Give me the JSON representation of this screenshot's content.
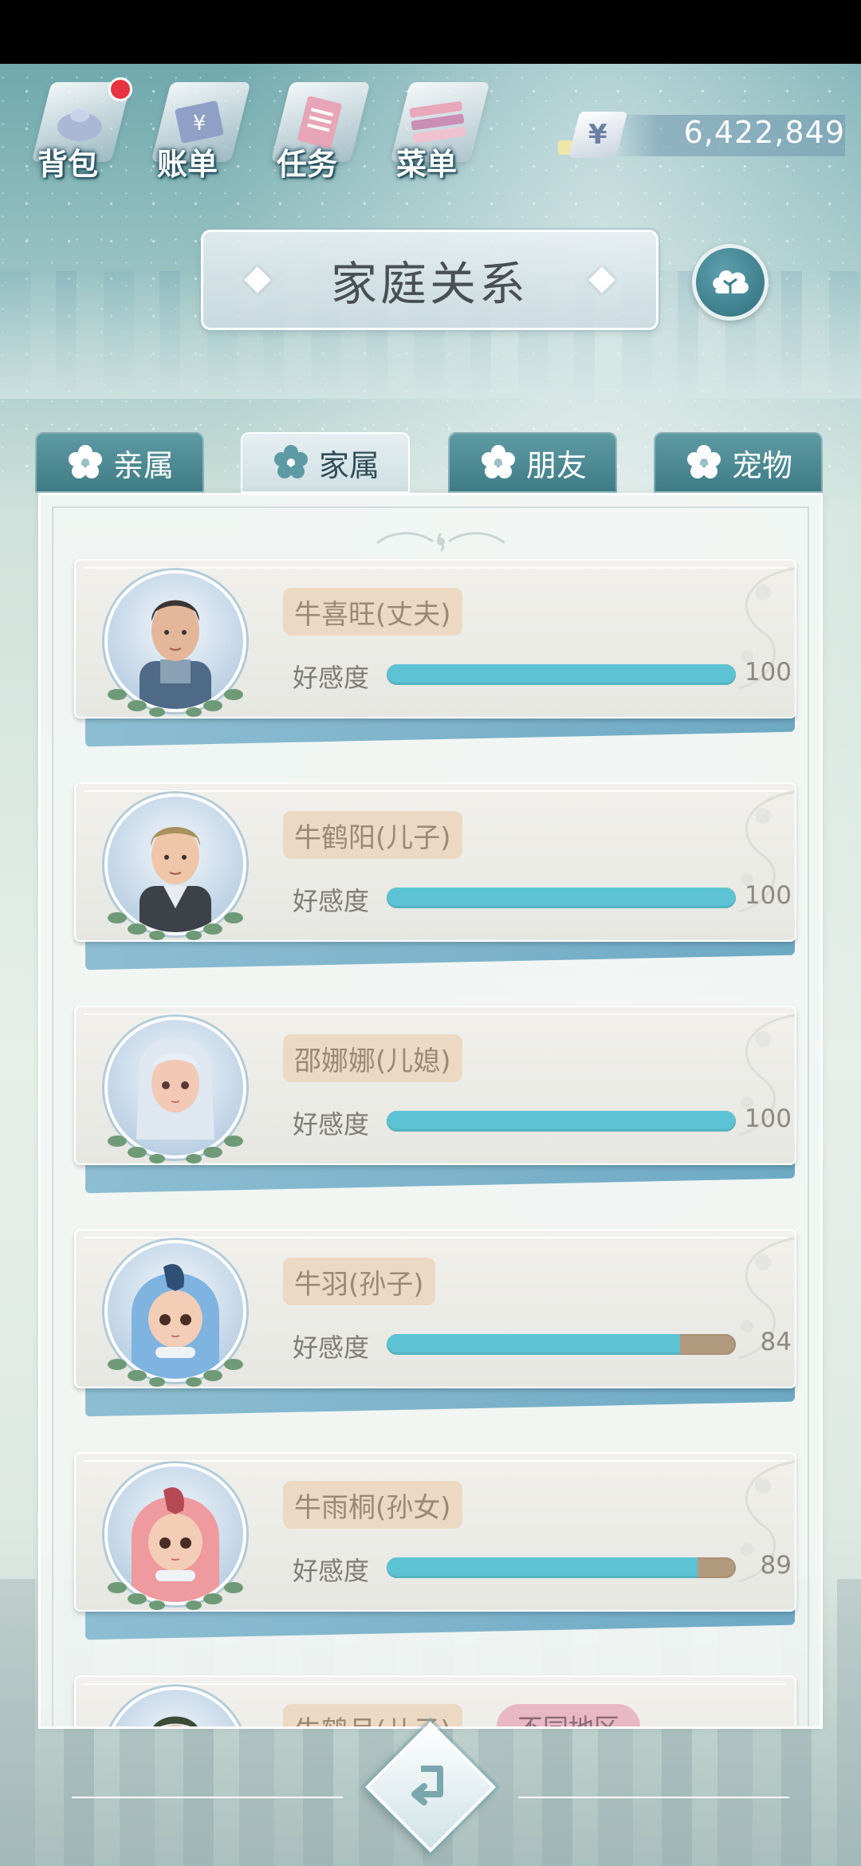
{
  "topnav": {
    "items": [
      {
        "label": "背包",
        "icon": "backpack-icon"
      },
      {
        "label": "账单",
        "icon": "bill-icon"
      },
      {
        "label": "任务",
        "icon": "task-icon"
      },
      {
        "label": "菜单",
        "icon": "menu-icon"
      }
    ],
    "currency_symbol": "¥",
    "money": "6,422,849"
  },
  "title": "家庭关系",
  "tabs": [
    {
      "label": "亲属",
      "active": false
    },
    {
      "label": "家属",
      "active": true
    },
    {
      "label": "朋友",
      "active": false
    },
    {
      "label": "宠物",
      "active": false
    }
  ],
  "affection_label": "好感度",
  "members": [
    {
      "name": "牛喜旺(丈夫)",
      "affection": 100
    },
    {
      "name": "牛鹤阳(儿子)",
      "affection": 100
    },
    {
      "name": "邵娜娜(儿媳)",
      "affection": 100
    },
    {
      "name": "牛羽(孙子)",
      "affection": 84
    },
    {
      "name": "牛雨桐(孙女)",
      "affection": 89
    },
    {
      "name": "牛鹤月(儿子)",
      "region_tag": "不同地区"
    }
  ],
  "colors": {
    "bar_fill": "#5cc3d4",
    "bar_track": "#b29a7f",
    "tab_active": "#e6eff1",
    "tab_inactive": "#4f8b94",
    "notification_dot": "#e7343f"
  }
}
